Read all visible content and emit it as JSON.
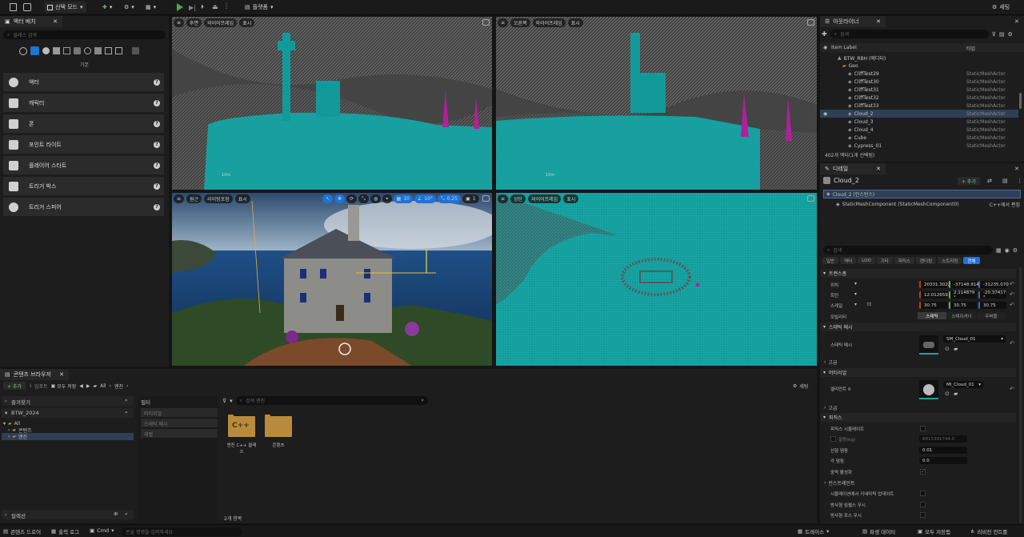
{
  "toolbar": {
    "mode_label": "선택 모드",
    "platform_label": "플랫폼",
    "settings_label": "세팅"
  },
  "place_actors": {
    "tab_title": "액터 배치",
    "search_placeholder": "클래스 검색",
    "category_label": "기본",
    "items": [
      "액터",
      "캐릭터",
      "폰",
      "포인트 라이트",
      "플레이어 스타트",
      "트리거 박스",
      "트리거 스피어"
    ]
  },
  "viewports": {
    "top_left": {
      "view": "후면",
      "mode": "와이어프레임",
      "show": "표시",
      "scale": "10m"
    },
    "top_right": {
      "view": "오른쪽",
      "mode": "와이어프레임",
      "show": "표시",
      "scale": "10m"
    },
    "bottom_left": {
      "view": "원근",
      "mode": "라이팅포함",
      "show": "표시",
      "grid_snap": "10",
      "rot_snap": "10°",
      "scale_snap": "0.25",
      "camera_speed": "1"
    },
    "bottom_right": {
      "view": "상단",
      "mode": "와이어프레임",
      "show": "표시"
    }
  },
  "outliner": {
    "tab_title": "아웃라이너",
    "search_placeholder": "검색",
    "col_label": "Item Label",
    "col_type": "타입",
    "world": "BTW_RBH (에디터)",
    "folder": "Geo",
    "rows": [
      {
        "label": "CliffTest29",
        "type": "StaticMeshActor"
      },
      {
        "label": "CliffTest30",
        "type": "StaticMeshActor"
      },
      {
        "label": "CliffTest31",
        "type": "StaticMeshActor"
      },
      {
        "label": "CliffTest32",
        "type": "StaticMeshActor"
      },
      {
        "label": "CliffTest33",
        "type": "StaticMeshActor"
      },
      {
        "label": "Cloud_2",
        "type": "StaticMeshActor"
      },
      {
        "label": "Cloud_3",
        "type": "StaticMeshActor"
      },
      {
        "label": "Cloud_4",
        "type": "StaticMeshActor"
      },
      {
        "label": "Cube",
        "type": "StaticMeshActor"
      },
      {
        "label": "Cypress_01",
        "type": "StaticMeshActor"
      }
    ],
    "selected_index": 5,
    "footer": "402개 액터(1개 선택됨)"
  },
  "details": {
    "tab_title": "디테일",
    "actor_name": "Cloud_2",
    "add_label": "+ 추가",
    "instance_label": "Cloud_2 (인스턴스)",
    "component_label": "StaticMeshComponent (StaticMeshComponent0)",
    "edit_cpp": "C++에서 편집",
    "search_placeholder": "검색",
    "filter_tabs": [
      "일반",
      "액터",
      "LOD",
      "기타",
      "피직스",
      "렌더링",
      "스트리밍",
      "전체"
    ],
    "active_filter": 7,
    "transform_section": "트랜스폼",
    "location_label": "위치",
    "rotation_label": "회전",
    "scale_label": "스케일",
    "location": [
      "20331.3022",
      "-37148.914",
      "-31235.070"
    ],
    "rotation": [
      "12.012659",
      "2.114879 °",
      "-20.37417 °"
    ],
    "scale": [
      "30.75",
      "30.75",
      "30.75"
    ],
    "mobility_label": "모빌리티",
    "mobility_options": [
      "스태틱",
      "스테이셔너",
      "무버블"
    ],
    "static_mesh_section": "스태틱 메시",
    "static_mesh_label": "스태틱 메시",
    "static_mesh_value": "SM_Cloud_01",
    "advanced_label": "고급",
    "materials_section": "머티리얼",
    "element0_label": "엘리먼트 0",
    "material_value": "MI_Cloud_01",
    "advanced_label2": "고급",
    "physics_section": "피직스",
    "simulate_physics": "피직스 시뮬레이트",
    "mass_label": "질량(kg)",
    "mass_value": "8815391744.0",
    "linear_damping_label": "선형 댐핑",
    "linear_damping": "0.01",
    "angular_damping_label": "각 댐핑",
    "angular_damping": "0.0",
    "gravity_label": "중력 활성화",
    "constraints_label": "컨스트레인트",
    "kinematic_label": "시뮬레이션에서 키네마틱 업데이트",
    "ignore_radial_impulse": "방사형 임펄스 무시",
    "ignore_radial_force": "방사형 포스 무시"
  },
  "content_browser": {
    "tab_title": "콘텐츠 브라우저",
    "add_label": "+ 추가",
    "import_label": "임포트",
    "save_all_label": "모두 저장",
    "breadcrumb": [
      "All",
      "엔진"
    ],
    "settings_label": "세팅",
    "favorites_label": "즐겨찾기",
    "project_label": "BTW_2024",
    "tree": [
      "All",
      "콘텐츠",
      "엔진"
    ],
    "collections_label": "컬렉션",
    "filters_label": "필터",
    "filter_items": [
      "머티리얼",
      "스태틱 메시",
      "레벨"
    ],
    "search_placeholder": "검색 엔진",
    "assets": [
      {
        "name": "엔진 C++ 클래스",
        "icon": "C++"
      },
      {
        "name": "콘텐츠",
        "icon": ""
      }
    ],
    "item_count": "2개 항목"
  },
  "statusbar": {
    "content_drawer": "콘텐츠 드로어",
    "output_log": "출력 로그",
    "cmd": "Cmd",
    "console_placeholder": "콘솔 명령을 입력하세요",
    "trace": "트레이스",
    "derived_data": "파생 데이터",
    "save_all": "모두 저장됨",
    "revision_control": "리비전 컨트롤"
  },
  "colors": {
    "teal": "#1aa3a3",
    "magenta": "#b0209a",
    "accent": "#1e73d8"
  }
}
